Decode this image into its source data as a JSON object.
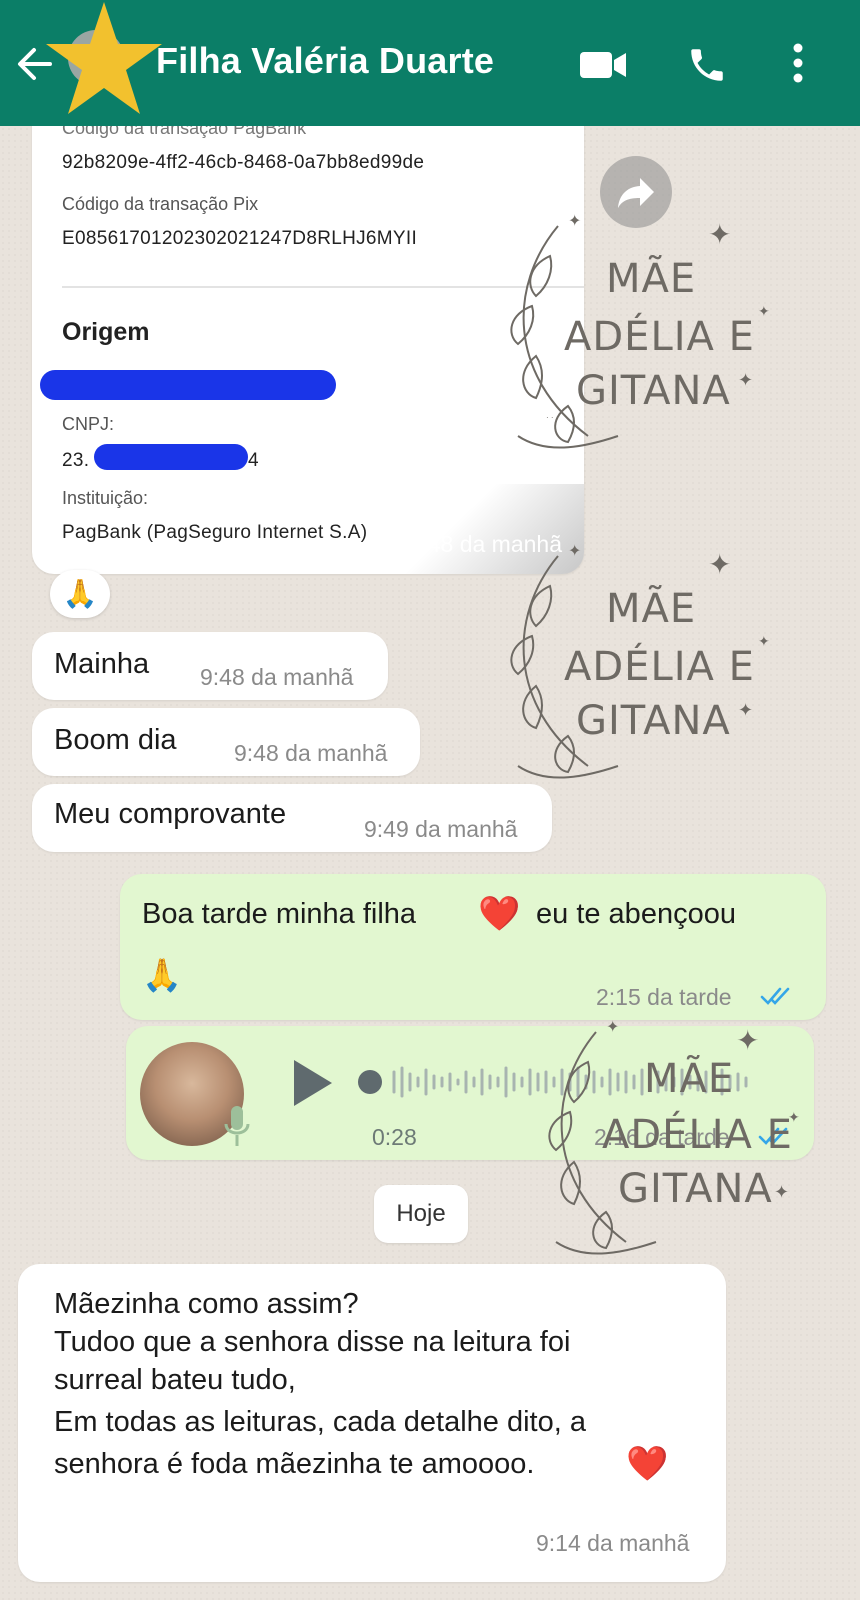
{
  "header": {
    "contact_name": "Filha Valéria Duarte",
    "back_icon": "arrow-left-icon",
    "video_icon": "video-camera-icon",
    "call_icon": "phone-icon",
    "menu_icon": "more-vertical-icon",
    "brand_color": "#0b7e67"
  },
  "receipt": {
    "pagbank_code_label": "Código da transação PagBank",
    "pagbank_code": "92b8209e-4ff2-46cb-8468-0a7bb8ed99de",
    "pix_code_label": "Código da transação Pix",
    "pix_code": "E08561701202302021247D8RLHJ6MYII",
    "origin_title": "Origem",
    "cnpj_label": "CNPJ:",
    "cnpj_partial": "23.",
    "cnpj_end": "4",
    "institution_label": "Instituição:",
    "institution": "PagBank (PagSeguro Internet S.A)",
    "time": "9:48 da manhã"
  },
  "reaction_emoji": "🙏",
  "messages_in": [
    {
      "text": "Mainha",
      "time": "9:48 da manhã"
    },
    {
      "text": "Boom dia",
      "time": "9:48 da manhã"
    },
    {
      "text": "Meu comprovante",
      "time": "9:49 da manhã"
    }
  ],
  "message_out": {
    "text_a": "Boa tarde minha filha",
    "emoji_heart": "❤️",
    "text_b": "eu te abençoou",
    "emoji_pray": "🙏",
    "time": "2:15 da tarde"
  },
  "voice_note": {
    "duration": "0:28",
    "time": "2:16 da tarde"
  },
  "date_chip": "Hoje",
  "last_message": {
    "line1": "Mãezinha como assim?",
    "line2": "Tudoo que a senhora disse na leitura   foi",
    "line3": "surreal bateu tudo,",
    "line4": "Em todas as leituras, cada detalhe dito, a",
    "line5": "senhora é foda mãezinha te amoooo.",
    "emoji": "❤️",
    "time": "9:14 da manhã"
  },
  "watermark": {
    "line1": "MÃE",
    "line2": "ADÉLIA E",
    "line3": "GITANA"
  },
  "colors": {
    "incoming_bubble": "#ffffff",
    "outgoing_bubble": "#e2f7d0",
    "read_ticks": "#34b7f1",
    "star": "#f2c12e"
  }
}
